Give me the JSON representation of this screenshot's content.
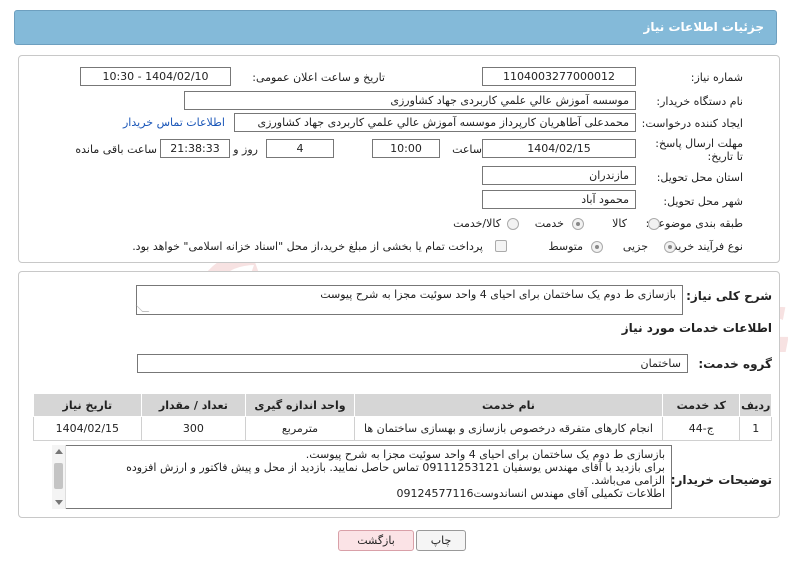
{
  "header": {
    "title": "جزئیات اطلاعات نیاز"
  },
  "fields": {
    "need_number_label": "شماره نیاز:",
    "need_number": "1104003277000012",
    "announce_label": "تاریخ و ساعت اعلان عمومی:",
    "announce_value": "1404/02/10 - 10:30",
    "buyer_org_label": "نام دستگاه خریدار:",
    "buyer_org": "موسسه آموزش عالي علمي کاربردی جهاد کشاورزی",
    "creator_label": "ایجاد کننده درخواست:",
    "creator": "محمدعلی آطاهریان کارپرداز موسسه آموزش عالي علمي کاربردی جهاد کشاورزی",
    "buyer_contact_link": "اطلاعات تماس خریدار",
    "deadline_label": "مهلت ارسال پاسخ: تا تاریخ:",
    "deadline_date": "1404/02/15",
    "time_label": "ساعت",
    "deadline_time": "10:00",
    "days_value": "4",
    "days_label": "روز و",
    "remaining_time": "21:38:33",
    "remaining_label": "ساعت باقی مانده",
    "province_label": "استان محل تحویل:",
    "province": "مازندران",
    "city_label": "شهر محل تحویل:",
    "city": "محمود آباد",
    "category_label": "طبقه بندی موضوعی:",
    "category_options": [
      "کالا",
      "خدمت",
      "کالا/خدمت"
    ],
    "category_selected": "خدمت",
    "process_label": "نوع فرآیند خرید :",
    "process_options": [
      "جزیی",
      "متوسط"
    ],
    "process_selected": "جزیی",
    "payment_note": "پرداخت تمام یا بخشی از مبلغ خرید،از محل \"اسناد خزانه اسلامی\" خواهد بود."
  },
  "description": {
    "label": "شرح کلی نیاز:",
    "value": "بازسازی ط دوم یک ساختمان برای احیای 4 واحد سوئیت مجزا به شرح پیوست"
  },
  "services": {
    "section_title": "اطلاعات خدمات مورد نیاز",
    "group_label": "گروه خدمت:",
    "group_value": "ساختمان",
    "columns": [
      "ردیف",
      "کد خدمت",
      "نام خدمت",
      "واحد اندازه گیری",
      "تعداد / مقدار",
      "تاریخ نیاز"
    ],
    "rows": [
      [
        "1",
        "ج-44",
        "انجام کارهای متفرقه درخصوص بازسازی و بهسازی ساختمان ها",
        "مترمربع",
        "300",
        "1404/02/15"
      ]
    ]
  },
  "buyer_notes": {
    "label": "توضیحات خریدار:",
    "lines": [
      "بازسازی ط دوم یک ساختمان برای احیای 4 واحد سوئیت مجزا به شرح پیوست.",
      "برای  بازدید با آقای مهندس یوسفیان 09111253121 تماس حاصل نمایید. بازدید از محل و  پیش فاکتور و ارزش افزوده",
      "الزامی می‌باشد.",
      "اطلاعات تکمیلی آقای مهندس انساندوست09124577116"
    ]
  },
  "buttons": {
    "print": "چاپ",
    "back": "بازگشت"
  },
  "watermark": {
    "text": "AriaTender.neT"
  },
  "colors": {
    "header_bg": "#84bad9",
    "link": "#1a56b8",
    "back_button": "#fbe3e6"
  }
}
